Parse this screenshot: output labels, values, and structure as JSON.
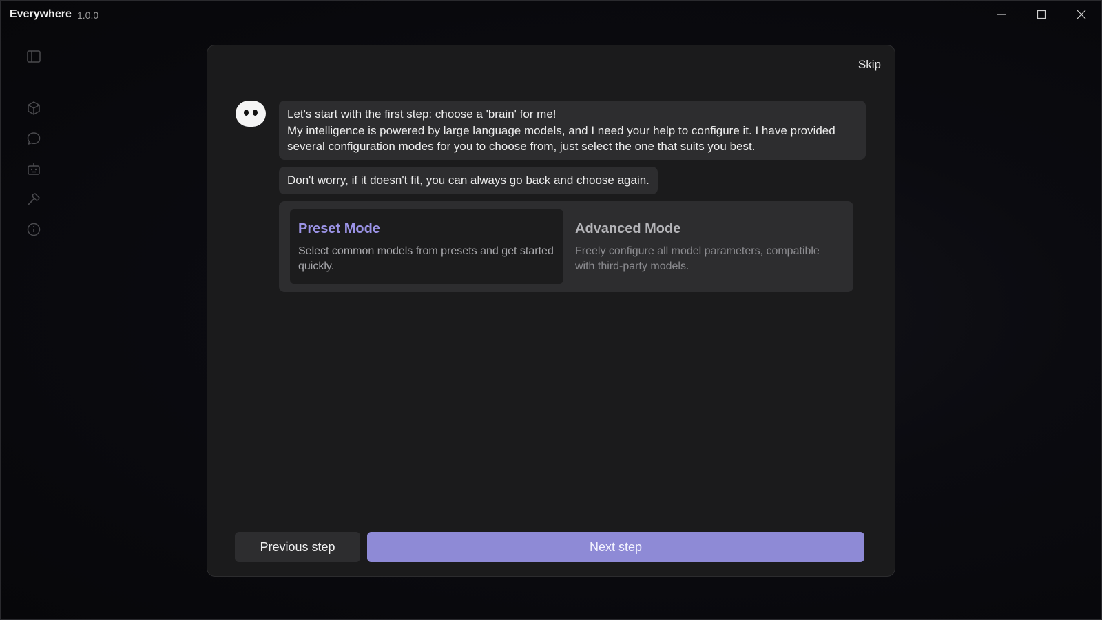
{
  "window": {
    "title": "Everywhere",
    "version": "1.0.0",
    "controls": {
      "minimize": "minimize-icon",
      "maximize": "maximize-icon",
      "close": "close-icon"
    }
  },
  "sidebar": {
    "items": [
      {
        "icon": "sidebar-toggle-icon"
      },
      {
        "icon": "cube-icon"
      },
      {
        "icon": "chat-icon"
      },
      {
        "icon": "robot-icon"
      },
      {
        "icon": "tools-icon"
      },
      {
        "icon": "info-icon"
      }
    ]
  },
  "dialog": {
    "skip_label": "Skip",
    "messages": [
      "Let's start with the first step: choose a 'brain' for me!\nMy intelligence is powered by large language models, and I need your help to configure it. I have provided several configuration modes for you to choose from, just select the one that suits you best.",
      "Don't worry, if it doesn't fit, you can always go back and choose again."
    ],
    "modes": [
      {
        "title": "Preset Mode",
        "description": "Select common models from presets and get started quickly.",
        "selected": true
      },
      {
        "title": "Advanced Mode",
        "description": "Freely configure all model parameters, compatible with third-party models.",
        "selected": false
      }
    ],
    "buttons": {
      "previous": "Previous step",
      "next": "Next step"
    }
  },
  "colors": {
    "accent": "#8e8ad6",
    "accent_text": "#9b93e6",
    "bubble": "#2d2d2f",
    "dialog": "#1b1b1c"
  }
}
